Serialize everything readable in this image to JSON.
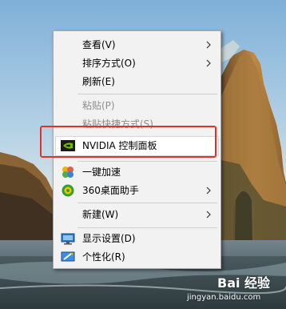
{
  "menu": {
    "items": [
      {
        "label": "查看(V)",
        "submenu": true,
        "disabled": false
      },
      {
        "label": "排序方式(O)",
        "submenu": true,
        "disabled": false
      },
      {
        "label": "刷新(E)",
        "submenu": false,
        "disabled": false
      },
      {
        "label": "粘贴(P)",
        "submenu": false,
        "disabled": true
      },
      {
        "label": "粘贴快捷方式(S)",
        "submenu": false,
        "disabled": true
      },
      {
        "label": "NVIDIA 控制面板",
        "submenu": false,
        "disabled": false,
        "icon": "nvidia-icon",
        "highlighted": true
      },
      {
        "label": "一键加速",
        "submenu": false,
        "disabled": false,
        "icon": "speedup-icon"
      },
      {
        "label": "360桌面助手",
        "submenu": true,
        "disabled": false,
        "icon": "360-icon"
      },
      {
        "label": "新建(W)",
        "submenu": true,
        "disabled": false
      },
      {
        "label": "显示设置(D)",
        "submenu": false,
        "disabled": false,
        "icon": "display-settings-icon"
      },
      {
        "label": "个性化(R)",
        "submenu": false,
        "disabled": false,
        "icon": "personalize-icon"
      }
    ]
  },
  "watermark": {
    "logo": "Bai 经验",
    "url": "jingyan.baidu.com"
  },
  "colors": {
    "highlight_box": "#e0322d",
    "menu_bg": "#f2f2f2",
    "nvidia_green": "#76b900"
  }
}
